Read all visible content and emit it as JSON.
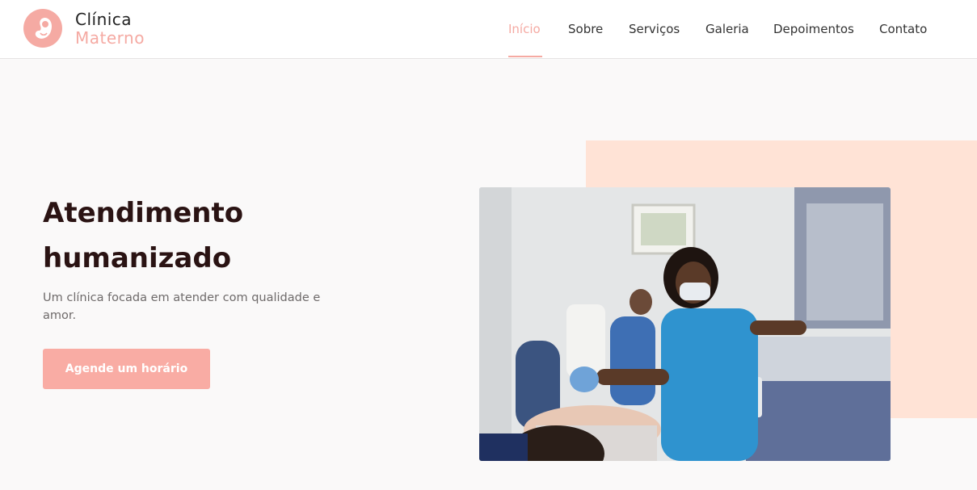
{
  "brand": {
    "line1": "Clínica",
    "line2": "Materno",
    "icon": "baby-embryo-icon",
    "accent": "#f5aaa3"
  },
  "nav": {
    "items": [
      {
        "label": "Início",
        "active": true
      },
      {
        "label": "Sobre",
        "active": false
      },
      {
        "label": "Serviços",
        "active": false
      },
      {
        "label": "Galeria",
        "active": false
      },
      {
        "label": "Depoimentos",
        "active": false
      },
      {
        "label": "Contato",
        "active": false
      }
    ]
  },
  "hero": {
    "title_line1": "Atendimento",
    "title_line2": "humanizado",
    "subtitle": "Um clínica focada em atender com qualidade e amor.",
    "cta_label": "Agende um horário",
    "background_accent": "#ffe3d6"
  }
}
